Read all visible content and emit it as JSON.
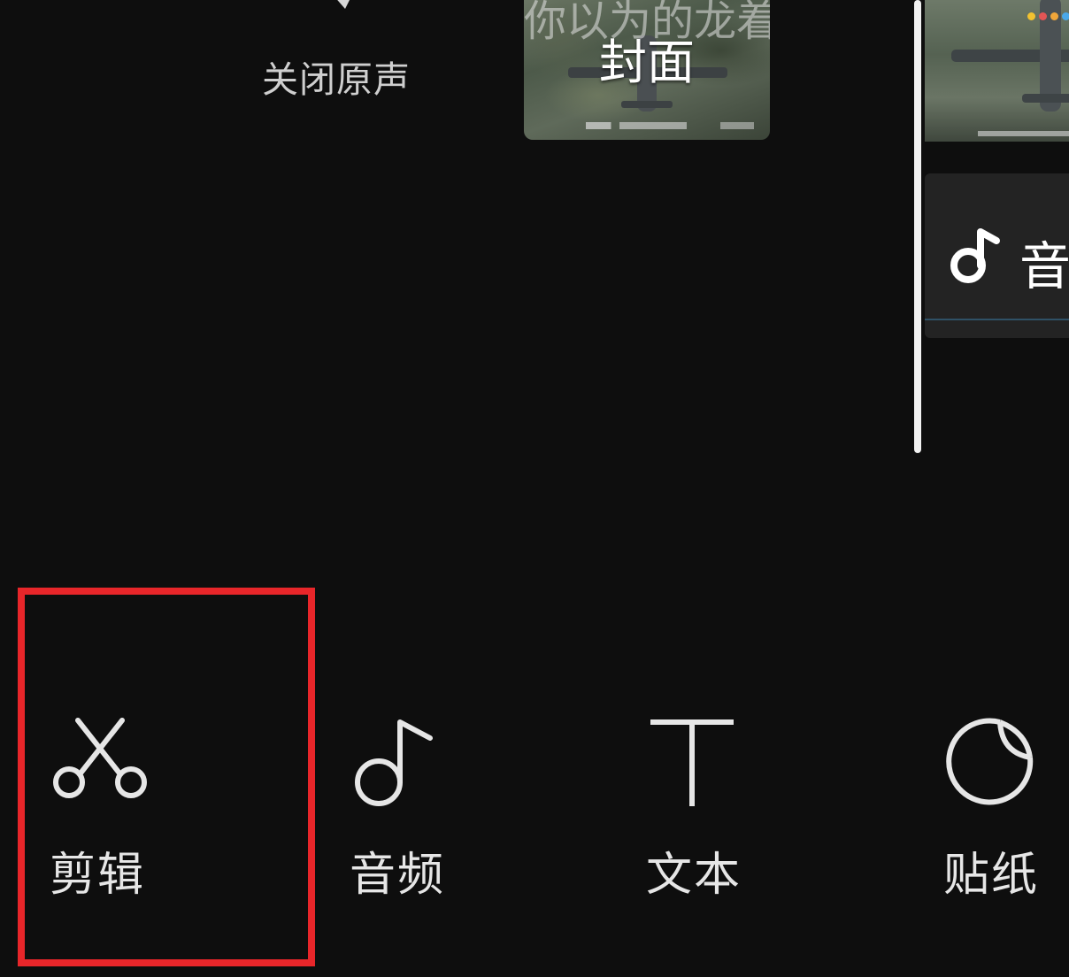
{
  "timeline": {
    "mute_label": "关闭原声",
    "cover": {
      "overlay_text": "你以为的龙着",
      "label": "封面"
    },
    "audio_track_label": "音"
  },
  "toolbar": {
    "items": [
      {
        "label": "剪辑",
        "icon": "scissors-icon"
      },
      {
        "label": "音频",
        "icon": "music-note-icon"
      },
      {
        "label": "文本",
        "icon": "text-t-icon"
      },
      {
        "label": "贴纸",
        "icon": "sticker-icon"
      }
    ]
  },
  "annotation": {
    "highlight_color": "#e8262a",
    "highlighted_item": "剪辑"
  },
  "colors": {
    "background": "#0e0e0e",
    "icon_stroke": "#e6e6e6",
    "track_background": "#232323",
    "cursor": "#f2f2f2"
  }
}
